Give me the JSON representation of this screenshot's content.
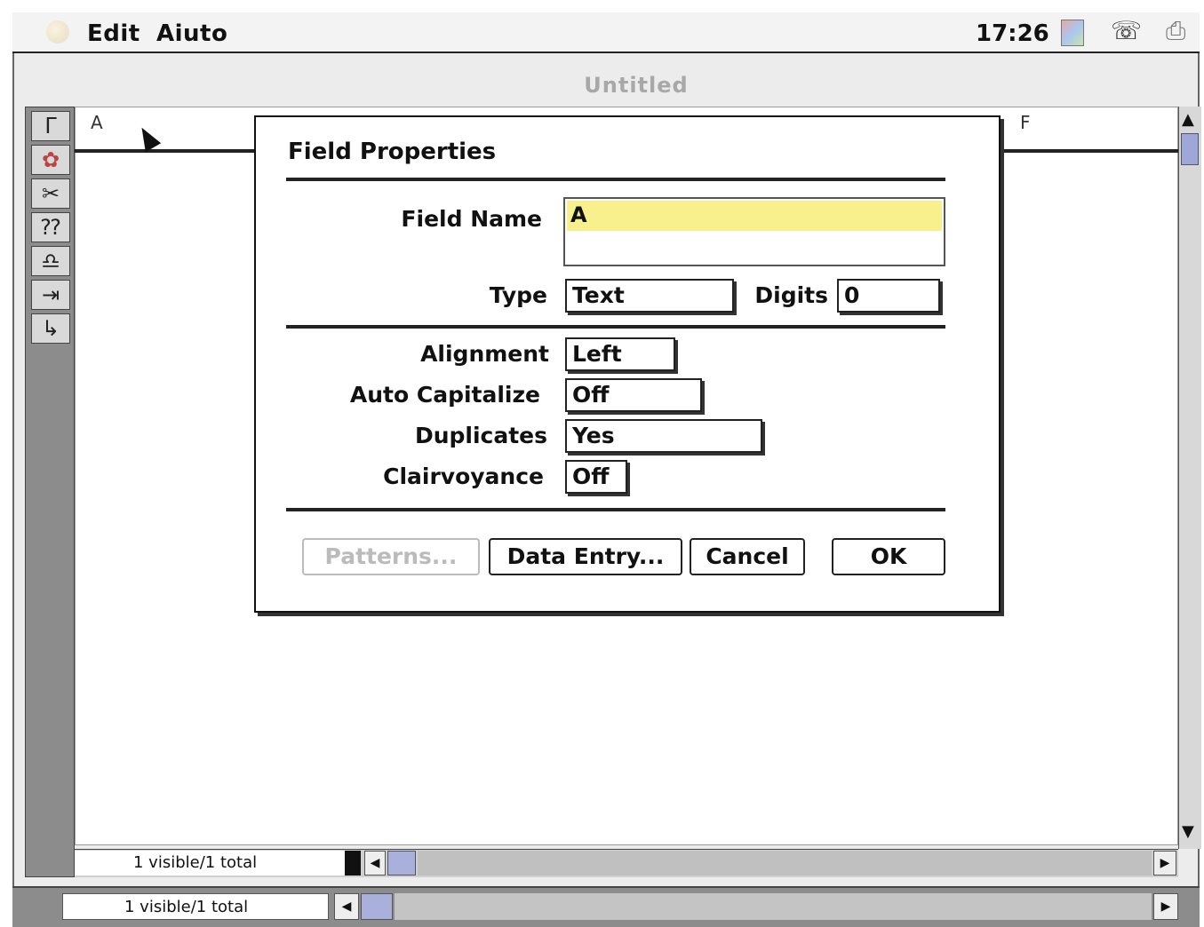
{
  "menubar": {
    "menus": [
      "Edit",
      "Aiuto"
    ],
    "clock": "17:26",
    "icons": [
      "apple-icon",
      "color-picker-icon",
      "application-switcher-icon",
      "app-menu-icon"
    ]
  },
  "window": {
    "title": "Untitled",
    "columns": [
      "A",
      "F"
    ],
    "tools": [
      "text-tool-icon",
      "lasso-tool-icon",
      "scissors-icon",
      "design-icon",
      "bell-icon",
      "tab-right-icon",
      "return-icon"
    ]
  },
  "dialog": {
    "title": "Field Properties",
    "field_name_label": "Field Name",
    "field_name_value": "A",
    "type_label": "Type",
    "type_value": "Text",
    "digits_label": "Digits",
    "digits_value": "0",
    "alignment_label": "Alignment",
    "alignment_value": "Left",
    "auto_capitalize_label": "Auto Capitalize",
    "auto_capitalize_value": "Off",
    "duplicates_label": "Duplicates",
    "duplicates_value": "Yes",
    "clairvoyance_label": "Clairvoyance",
    "clairvoyance_value": "Off",
    "buttons": {
      "patterns": "Patterns...",
      "data_entry": "Data Entry...",
      "cancel": "Cancel",
      "ok": "OK"
    }
  },
  "status": {
    "record_count_1": "1 visible/1 total",
    "record_count_2": "1 visible/1 total"
  }
}
